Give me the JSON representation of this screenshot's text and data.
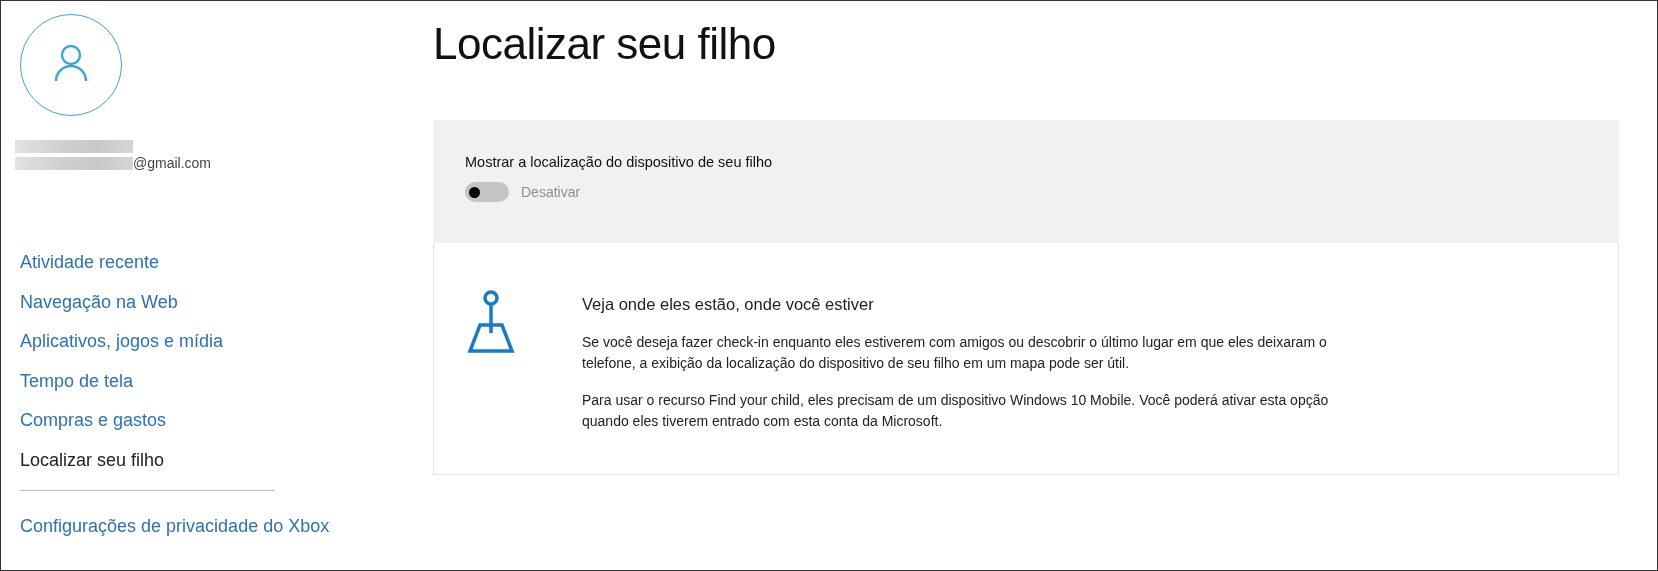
{
  "account": {
    "email_suffix": "@gmail.com"
  },
  "sidebar": {
    "items": [
      {
        "label": "Atividade recente",
        "selected": false
      },
      {
        "label": "Navegação na Web",
        "selected": false
      },
      {
        "label": "Aplicativos, jogos e mídia",
        "selected": false
      },
      {
        "label": "Tempo de tela",
        "selected": false
      },
      {
        "label": "Compras e gastos",
        "selected": false
      },
      {
        "label": "Localizar seu filho",
        "selected": true
      }
    ],
    "footer_link": "Configurações de privacidade do Xbox"
  },
  "page": {
    "title": "Localizar seu filho",
    "setting": {
      "label": "Mostrar a localização do dispositivo de seu filho",
      "on": false,
      "disabled": true,
      "state_text": "Desativar"
    },
    "info": {
      "heading": "Veja onde eles estão, onde você estiver",
      "paragraphs": [
        "Se você deseja fazer check-in enquanto eles estiverem com amigos ou descobrir o último lugar em que eles deixaram o telefone, a exibição da localização do dispositivo de seu filho em um mapa pode ser útil.",
        "Para usar o recurso Find your child, eles precisam de um dispositivo Windows 10 Mobile. Você poderá ativar esta opção quando eles tiverem entrado com esta conta da Microsoft."
      ]
    }
  }
}
